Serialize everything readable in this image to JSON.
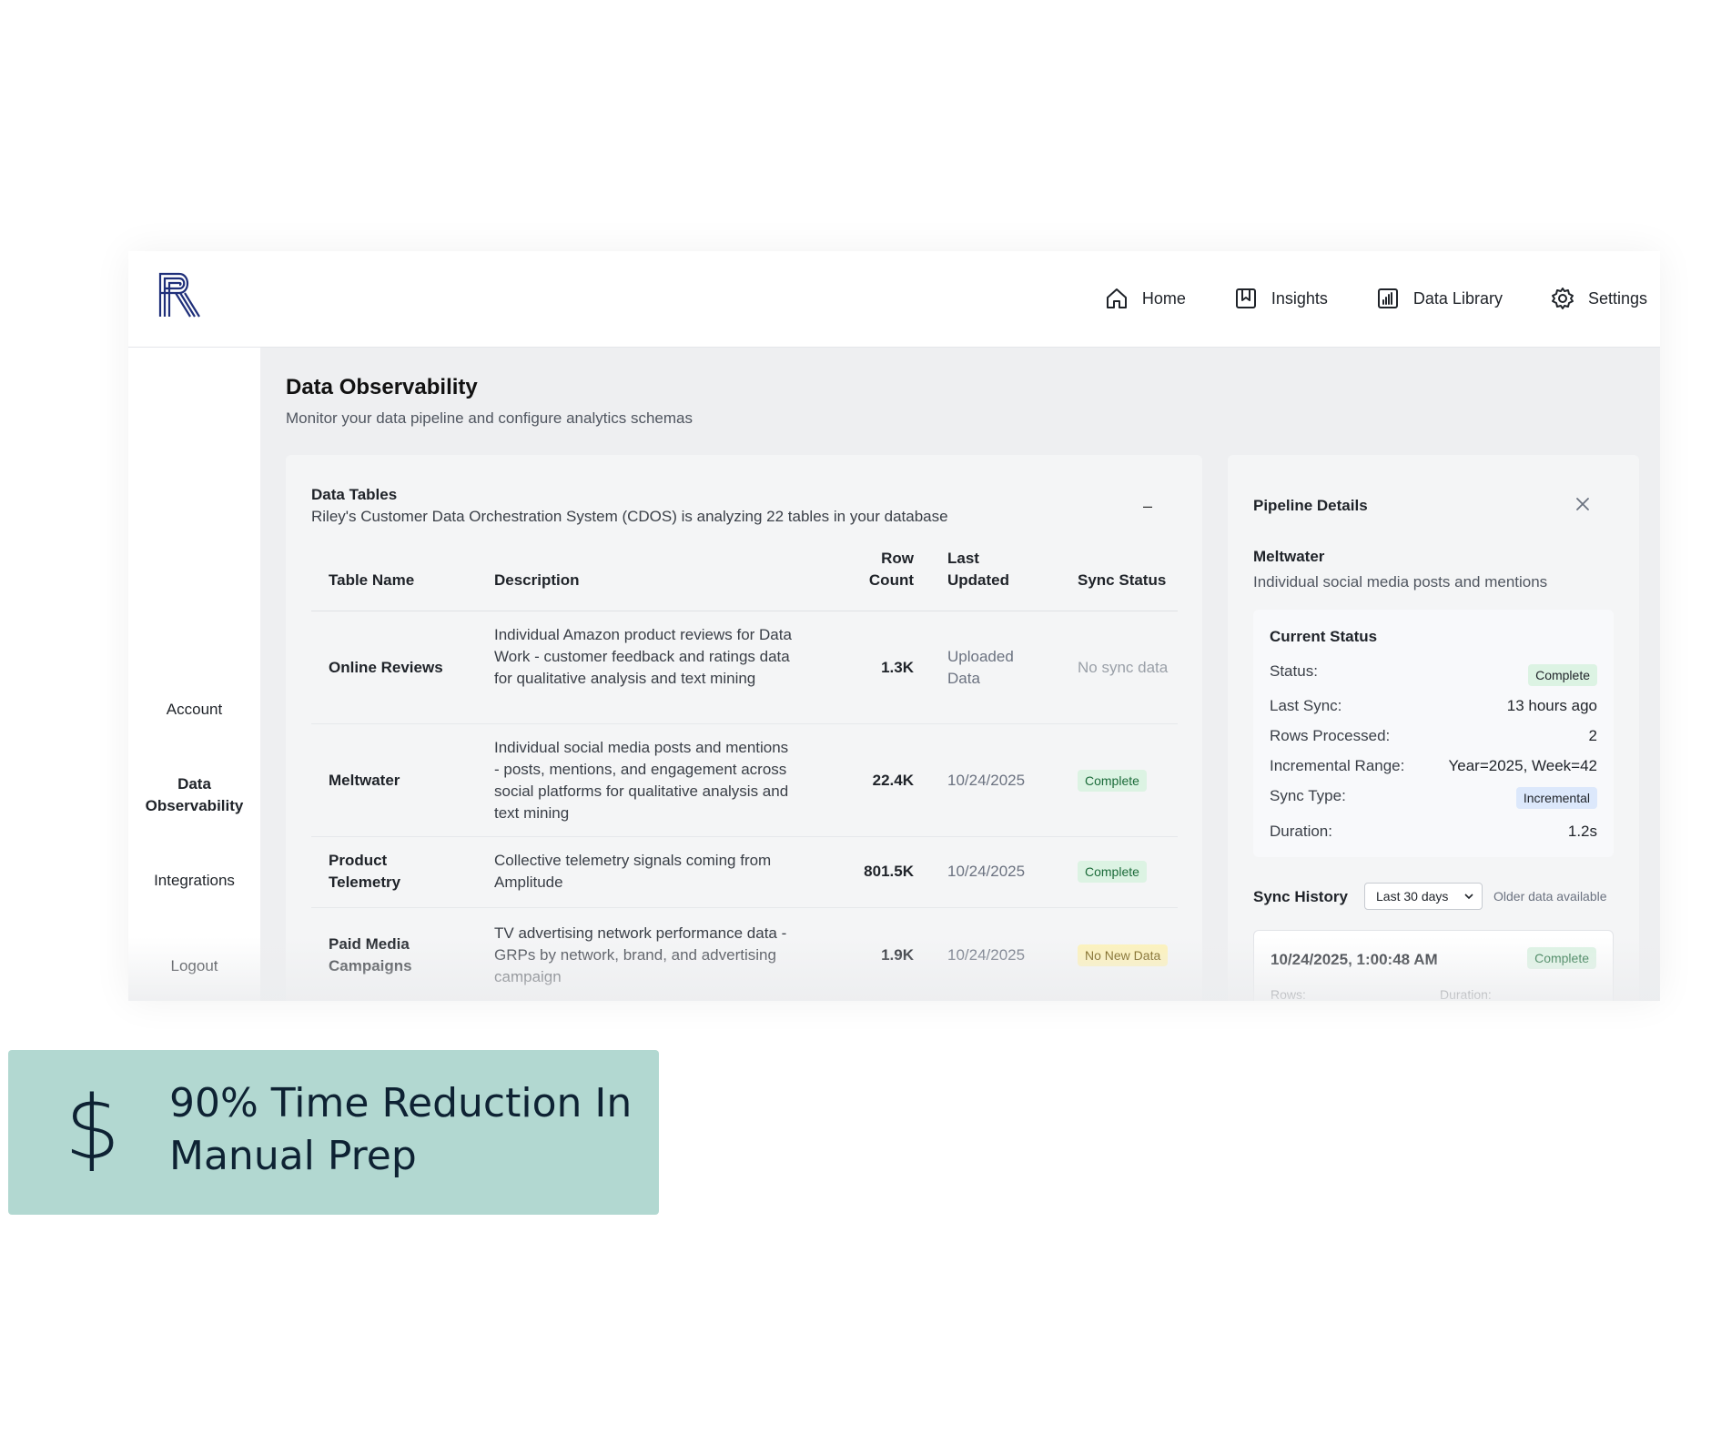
{
  "nav": {
    "items": [
      {
        "label": "Home",
        "icon": "home-icon"
      },
      {
        "label": "Insights",
        "icon": "bookmark-icon"
      },
      {
        "label": "Data Library",
        "icon": "chart-icon"
      },
      {
        "label": "Settings",
        "icon": "gear-icon"
      }
    ]
  },
  "sidebar": {
    "items": [
      {
        "label": "Account"
      },
      {
        "label": "Data Observability",
        "active": true
      },
      {
        "label": "Integrations"
      },
      {
        "label": "Logout"
      }
    ]
  },
  "page": {
    "title": "Data Observability",
    "subtitle": "Monitor your data pipeline and configure analytics schemas"
  },
  "tables_card": {
    "title": "Data Tables",
    "subtitle": "Riley's Customer Data Orchestration System (CDOS) is analyzing 22 tables in your database",
    "collapse": "–",
    "headers": {
      "name": "Table Name",
      "description": "Description",
      "row_count_1": "Row",
      "row_count_2": "Count",
      "last_updated_1": "Last",
      "last_updated_2": "Updated",
      "sync_status": "Sync Status"
    },
    "rows": [
      {
        "name": "Online Reviews",
        "description": "Individual Amazon product reviews for Data Work - customer feedback and ratings data for qualitative analysis and text mining",
        "count": "1.3K",
        "updated": "Uploaded Data",
        "status": "No sync data"
      },
      {
        "name": "Meltwater",
        "description": "Individual social media posts and mentions - posts, mentions, and engagement across social platforms for qualitative analysis and text mining",
        "count": "22.4K",
        "updated": "10/24/2025",
        "status": "Complete"
      },
      {
        "name": "Product Telemetry",
        "description": "Collective telemetry signals coming from Amplitude",
        "count": "801.5K",
        "updated": "10/24/2025",
        "status": "Complete"
      },
      {
        "name": "Paid Media Campaigns",
        "description": "TV advertising network performance data - GRPs by network, brand, and advertising campaign",
        "count": "1.9K",
        "updated": "10/24/2025",
        "status": "No New Data"
      }
    ]
  },
  "pipeline": {
    "title": "Pipeline Details",
    "name": "Meltwater",
    "description": "Individual social media posts and mentions",
    "current_status": {
      "title": "Current Status",
      "status_label": "Status:",
      "status_value": "Complete",
      "last_sync_label": "Last Sync:",
      "last_sync_value": "13 hours ago",
      "rows_label": "Rows Processed:",
      "rows_value": "2",
      "range_label": "Incremental Range:",
      "range_value": "Year=2025, Week=42",
      "type_label": "Sync Type:",
      "type_value": "Incremental",
      "duration_label": "Duration:",
      "duration_value": "1.2s"
    },
    "sync_history": {
      "title": "Sync History",
      "range": "Last 30 days",
      "older": "Older data available",
      "entry": {
        "date": "10/24/2025, 1:00:48 AM",
        "status": "Complete",
        "rows_label": "Rows:",
        "duration_label": "Duration:"
      }
    }
  },
  "promo": {
    "icon": "dollar-icon",
    "symbol": "$",
    "text": "90% Time Reduction In Manual Prep"
  },
  "colors": {
    "brand": "#1f2f7a",
    "promo_bg": "#b2d8d1",
    "complete_bg": "#dcf3e3",
    "no_new_bg": "#fdf2b8",
    "incremental_bg": "#dce8fb"
  }
}
